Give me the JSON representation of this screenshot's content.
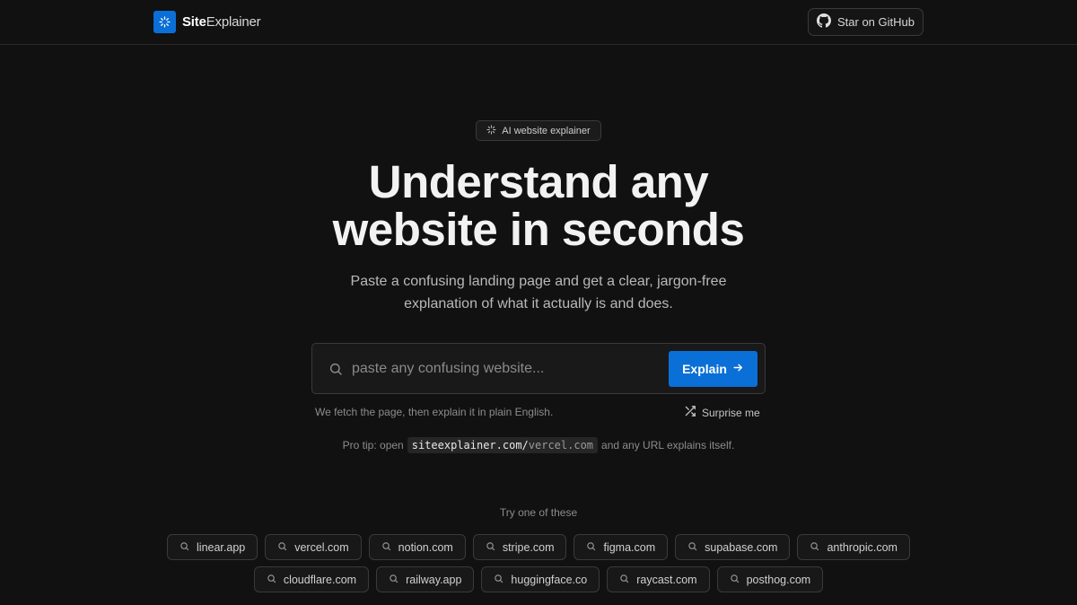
{
  "nav": {
    "brand_bold": "Site",
    "brand_light": "Explainer",
    "github_label": "Star on GitHub"
  },
  "hero": {
    "pill_label": "AI website explainer",
    "title_line1": "Understand any",
    "title_line2": "website in seconds",
    "subtitle": "Paste a confusing landing page and get a clear, jargon-free explanation of what it actually is and does."
  },
  "search": {
    "placeholder": "paste any confusing website...",
    "value": "",
    "button_label": "Explain",
    "helper_text": "We fetch the page, then explain it in plain English.",
    "surprise_label": "Surprise me"
  },
  "protip": {
    "prefix": "Pro tip: open",
    "code_host": "siteexplainer.com/",
    "code_path": "vercel.com",
    "suffix": "and any URL explains itself."
  },
  "examples": {
    "heading": "Try one of these",
    "row1": [
      "linear.app",
      "vercel.com",
      "notion.com",
      "stripe.com",
      "figma.com",
      "supabase.com",
      "anthropic.com"
    ],
    "row2": [
      "cloudflare.com",
      "railway.app",
      "huggingface.co",
      "raycast.com",
      "posthog.com"
    ]
  },
  "colors": {
    "background": "#111111",
    "accent": "#0a6fd6",
    "border": "#3a3a3a"
  },
  "icons": {
    "brand": "spinner-icon",
    "github": "github-icon",
    "pill": "sparkle-icon",
    "search": "search-icon",
    "explain": "arrow-right-icon",
    "surprise": "shuffle-icon",
    "chip": "search-icon"
  }
}
